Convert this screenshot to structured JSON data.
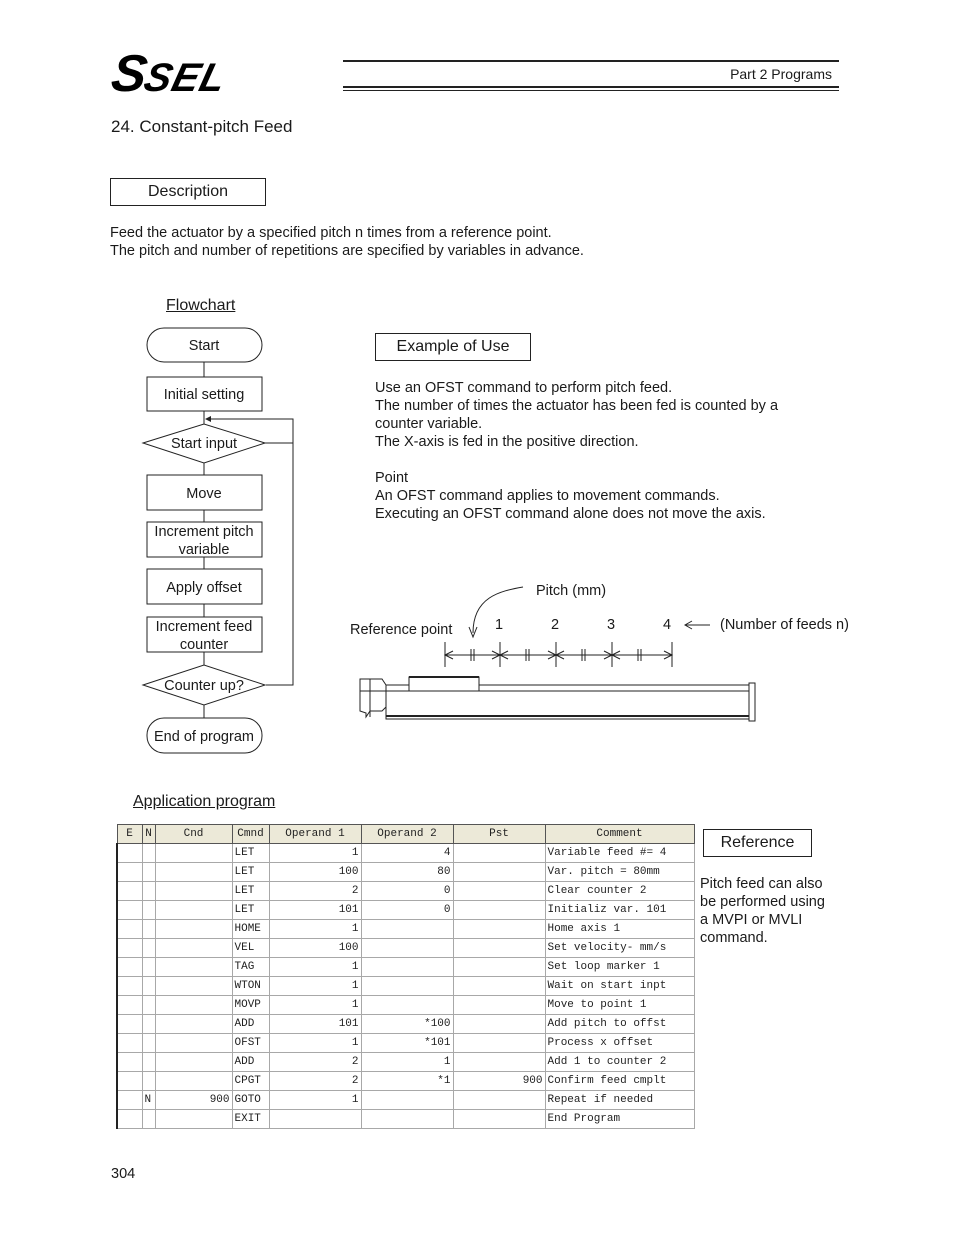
{
  "header": {
    "logo_s": "S",
    "logo_sel": "SEL",
    "part": "Part 2 Programs"
  },
  "section_title": "24.  Constant-pitch Feed",
  "description": {
    "label": "Description",
    "lines": [
      "Feed the actuator by a specified pitch n times from a reference point.",
      "The pitch and number of repetitions are specified by variables in advance."
    ]
  },
  "flowchart": {
    "title": "Flowchart",
    "nodes": {
      "start": "Start",
      "initial": "Initial setting",
      "start_input": "Start input",
      "move": "Move",
      "inc_pitch_1": "Increment pitch",
      "inc_pitch_2": "variable",
      "apply_offset": "Apply offset",
      "inc_feed_1": "Increment feed",
      "inc_feed_2": "counter",
      "counter_up": "Counter up?",
      "end": "End of program"
    }
  },
  "example": {
    "label": "Example of Use",
    "lines": [
      "Use an OFST command to perform pitch feed.",
      "The number of times the actuator has been fed is counted by a",
      "counter variable.",
      "The X-axis is fed in the positive direction."
    ],
    "point_title": "Point",
    "point_lines": [
      "An OFST command applies to movement commands.",
      "Executing an OFST command alone does not move the axis."
    ]
  },
  "diagram": {
    "pitch_label": "Pitch (mm)",
    "reference_label": "Reference point",
    "feed_numbers": [
      "1",
      "2",
      "3",
      "4"
    ],
    "feeds_label": "(Number of feeds n)"
  },
  "program": {
    "title": "Application program",
    "columns": [
      "E",
      "N",
      "Cnd",
      "Cmnd",
      "Operand 1",
      "Operand 2",
      "Pst",
      "Comment"
    ],
    "rows": [
      [
        "",
        "",
        "",
        "LET",
        "1",
        "4",
        "",
        "Variable feed #= 4"
      ],
      [
        "",
        "",
        "",
        "LET",
        "100",
        "80",
        "",
        "Var. pitch = 80mm"
      ],
      [
        "",
        "",
        "",
        "LET",
        "2",
        "0",
        "",
        "Clear counter 2"
      ],
      [
        "",
        "",
        "",
        "LET",
        "101",
        "0",
        "",
        "Initializ var. 101"
      ],
      [
        "",
        "",
        "",
        "HOME",
        "1",
        "",
        "",
        "Home axis 1"
      ],
      [
        "",
        "",
        "",
        "VEL",
        "100",
        "",
        "",
        "Set velocity- mm/s"
      ],
      [
        "",
        "",
        "",
        "TAG",
        "1",
        "",
        "",
        "Set loop marker 1"
      ],
      [
        "",
        "",
        "",
        "WTON",
        "1",
        "",
        "",
        "Wait on start inpt"
      ],
      [
        "",
        "",
        "",
        "MOVP",
        "1",
        "",
        "",
        "Move to point 1"
      ],
      [
        "",
        "",
        "",
        "ADD",
        "101",
        "*100",
        "",
        "Add pitch to offst"
      ],
      [
        "",
        "",
        "",
        "OFST",
        "1",
        "*101",
        "",
        "Process x offset"
      ],
      [
        "",
        "",
        "",
        "ADD",
        "2",
        "1",
        "",
        "Add 1 to counter 2"
      ],
      [
        "",
        "",
        "",
        "CPGT",
        "2",
        "*1",
        "900",
        "Confirm feed cmplt"
      ],
      [
        "",
        "N",
        "900",
        "GOTO",
        "1",
        "",
        "",
        "Repeat if needed"
      ],
      [
        "",
        "",
        "",
        "EXIT",
        "",
        "",
        "",
        "End Program"
      ]
    ]
  },
  "reference": {
    "label": "Reference",
    "lines": [
      "Pitch feed can also",
      "be performed using",
      "a MVPI or MVLI",
      "command."
    ]
  },
  "page_number": "304"
}
